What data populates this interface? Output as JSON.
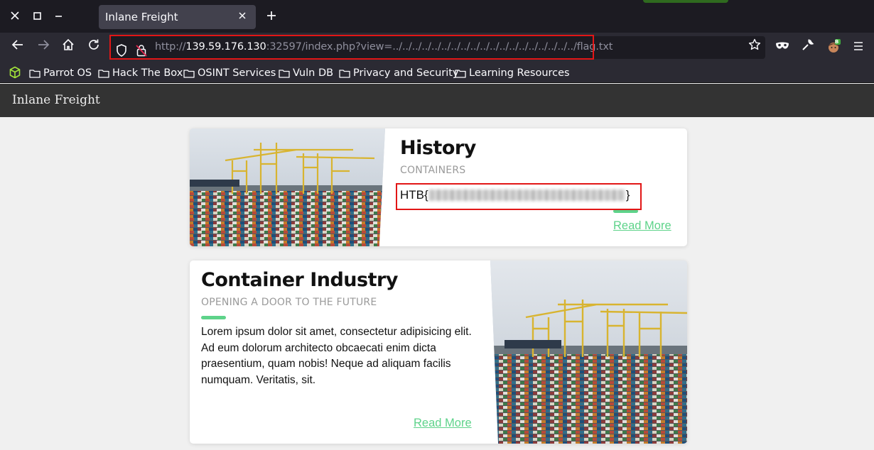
{
  "browser": {
    "tab_title": "Inlane Freight",
    "url_prefix": "http://",
    "url_host": "139.59.176.130",
    "url_rest": ":32597/index.php?view=../../../../../../../../../../../../../../../../../../../flag.txt",
    "bookmarks": [
      "Parrot OS",
      "Hack The Box",
      "OSINT Services",
      "Vuln DB",
      "Privacy and Security",
      "Learning Resources"
    ],
    "icons": {
      "close_window": "close-icon",
      "maximize": "maximize-icon",
      "minimize": "minimize-icon",
      "tab_close": "close-icon",
      "new_tab": "plus-icon",
      "back": "back-arrow-icon",
      "forward": "forward-arrow-icon",
      "home": "home-icon",
      "reload": "reload-icon",
      "shield": "shield-icon",
      "insecure_lock": "insecure-lock-icon",
      "bookmark_star": "star-icon",
      "extensions": [
        "mask-icon",
        "wrench-icon",
        "avatar-extension-icon"
      ],
      "menu": "hamburger-menu-icon"
    },
    "extension_badge": "B",
    "highlight_color": "#e21616"
  },
  "site": {
    "brand": "Inlane Freight",
    "accent_color": "#5ed38a"
  },
  "cards": [
    {
      "title": "History",
      "subtitle": "CONTAINERS",
      "flag_open": "HTB{",
      "flag_close": "}",
      "read_more": "Read More"
    },
    {
      "title": "Container Industry",
      "subtitle": "OPENING A DOOR TO THE FUTURE",
      "body": "Lorem ipsum dolor sit amet, consectetur adipisicing elit. Ad eum dolorum architecto obcaecati enim dicta praesentium, quam nobis! Neque ad aliquam facilis numquam. Veritatis, sit.",
      "read_more": "Read More"
    }
  ]
}
